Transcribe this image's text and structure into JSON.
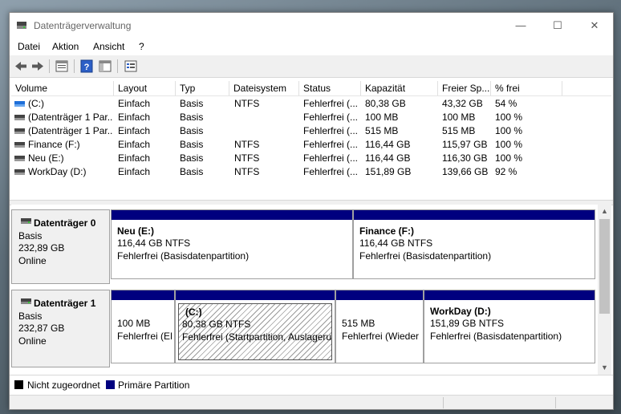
{
  "window": {
    "title": "Datenträgerverwaltung",
    "controls": {
      "minimize": "—",
      "maximize": "☐",
      "close": "✕"
    }
  },
  "menu": [
    "Datei",
    "Aktion",
    "Ansicht",
    "?"
  ],
  "toolbar": [
    "back-icon",
    "forward-icon",
    "properties-icon",
    "help-icon",
    "console-tree-icon",
    "settings-icon"
  ],
  "columns": [
    "Volume",
    "Layout",
    "Typ",
    "Dateisystem",
    "Status",
    "Kapazität",
    "Freier Sp...",
    "% frei"
  ],
  "volumes": [
    {
      "name": "(C:)",
      "layout": "Einfach",
      "type": "Basis",
      "fs": "NTFS",
      "status": "Fehlerfrei (...",
      "capacity": "80,38 GB",
      "free": "43,32 GB",
      "pct": "54 %",
      "selected_icon": true
    },
    {
      "name": "(Datenträger 1 Par...",
      "layout": "Einfach",
      "type": "Basis",
      "fs": "",
      "status": "Fehlerfrei (...",
      "capacity": "100 MB",
      "free": "100 MB",
      "pct": "100 %",
      "selected_icon": false
    },
    {
      "name": "(Datenträger 1 Par...",
      "layout": "Einfach",
      "type": "Basis",
      "fs": "",
      "status": "Fehlerfrei (...",
      "capacity": "515 MB",
      "free": "515 MB",
      "pct": "100 %",
      "selected_icon": false
    },
    {
      "name": "Finance (F:)",
      "layout": "Einfach",
      "type": "Basis",
      "fs": "NTFS",
      "status": "Fehlerfrei (...",
      "capacity": "116,44 GB",
      "free": "115,97 GB",
      "pct": "100 %",
      "selected_icon": false
    },
    {
      "name": "Neu (E:)",
      "layout": "Einfach",
      "type": "Basis",
      "fs": "NTFS",
      "status": "Fehlerfrei (...",
      "capacity": "116,44 GB",
      "free": "116,30 GB",
      "pct": "100 %",
      "selected_icon": false
    },
    {
      "name": "WorkDay (D:)",
      "layout": "Einfach",
      "type": "Basis",
      "fs": "NTFS",
      "status": "Fehlerfrei (...",
      "capacity": "151,89 GB",
      "free": "139,66 GB",
      "pct": "92 %",
      "selected_icon": false
    }
  ],
  "disks": [
    {
      "title": "Datenträger 0",
      "type": "Basis",
      "size": "232,89 GB",
      "state": "Online",
      "partitions": [
        {
          "name": "Neu  (E:)",
          "size": "116,44 GB NTFS",
          "status": "Fehlerfrei (Basisdatenpartition)",
          "hatched": false
        },
        {
          "name": "Finance  (F:)",
          "size": "116,44 GB NTFS",
          "status": "Fehlerfrei (Basisdatenpartition)",
          "hatched": false
        }
      ]
    },
    {
      "title": "Datenträger 1",
      "type": "Basis",
      "size": "232,87 GB",
      "state": "Online",
      "partitions": [
        {
          "name": "",
          "size": "100 MB",
          "status": "Fehlerfrei (EF",
          "hatched": false
        },
        {
          "name": "(C:)",
          "size": "80,38 GB NTFS",
          "status": "Fehlerfrei (Startpartition, Auslageru",
          "hatched": true
        },
        {
          "name": "",
          "size": "515 MB",
          "status": "Fehlerfrei (Wieder",
          "hatched": false
        },
        {
          "name": "WorkDay  (D:)",
          "size": "151,89 GB NTFS",
          "status": "Fehlerfrei (Basisdatenpartition)",
          "hatched": false
        }
      ]
    }
  ],
  "legend": [
    {
      "label": "Nicht zugeordnet",
      "color": "#000000"
    },
    {
      "label": "Primäre Partition",
      "color": "#00007f"
    }
  ],
  "scroll": {
    "up": "▲",
    "down": "▼"
  }
}
